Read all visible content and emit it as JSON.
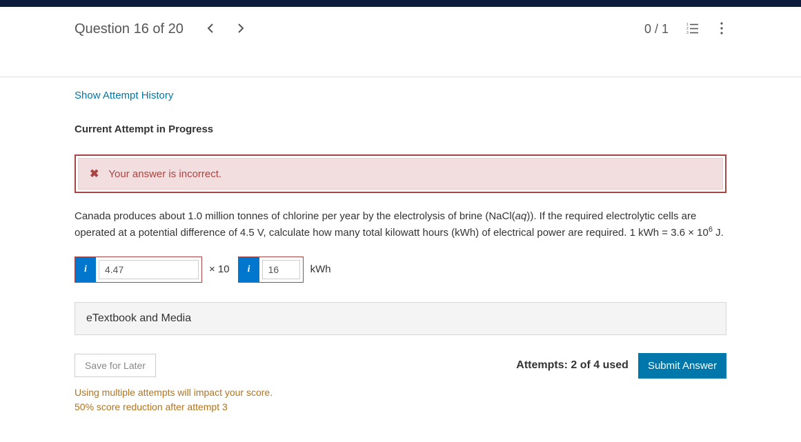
{
  "header": {
    "question_label": "Question 16 of 20",
    "score": "0 / 1"
  },
  "links": {
    "attempt_history": "Show Attempt History"
  },
  "attempt_heading": "Current Attempt in Progress",
  "alert": {
    "text": "Your answer is incorrect."
  },
  "question": {
    "part1": "Canada produces about 1.0 million tonnes of chlorine per year by the electrolysis of brine (NaCl(",
    "aq": "aq",
    "part2": ")). If the required electrolytic cells are operated at a potential difference of 4.5 V, calculate how many total kilowatt hours (kWh) of electrical power are required. 1 kWh = 3.6 × 10",
    "exp6": "6",
    "part3": " J."
  },
  "answer": {
    "coefficient": "4.47",
    "times_label": "× 10",
    "exponent": "16",
    "unit": "kWh"
  },
  "ebook_panel": "eTextbook and Media",
  "actions": {
    "save": "Save for Later",
    "attempts": "Attempts: 2 of 4 used",
    "submit": "Submit Answer"
  },
  "warnings": {
    "line1": "Using multiple attempts will impact your score.",
    "line2": "50% score reduction after attempt 3"
  }
}
